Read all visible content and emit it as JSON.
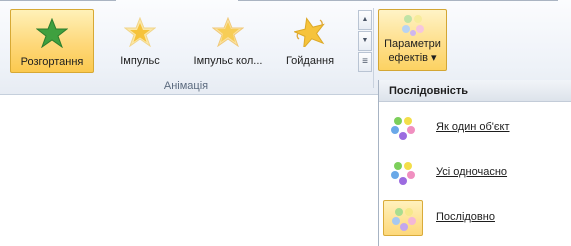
{
  "ribbon": {
    "effects": [
      {
        "label": "Розгортання",
        "selected": true,
        "color": "#3fa03f"
      },
      {
        "label": "Імпульс",
        "selected": false,
        "color": "#f6c33b"
      },
      {
        "label": "Імпульс кол...",
        "selected": false,
        "color": "#f6c33b"
      },
      {
        "label": "Гойдання",
        "selected": false,
        "color": "#f6c33b"
      }
    ],
    "group_label": "Анімація",
    "scroll": {
      "up": "▲",
      "down": "▼",
      "more": "≡"
    },
    "effect_options": {
      "line1": "Параметри",
      "line2": "ефектів ▾"
    }
  },
  "dropdown": {
    "header": "Послідовність",
    "items": [
      {
        "label": "Як один об'єкт",
        "selected": false
      },
      {
        "label": "Усі одночасно",
        "selected": false
      },
      {
        "label": "Послідовно",
        "selected": true
      }
    ]
  },
  "colors": {
    "accent_highlight": "#fdd87a",
    "dot_green": "#7ccf5a",
    "dot_yellow": "#f3de4a",
    "dot_blue": "#6aa8e8",
    "dot_pink": "#f08fc0",
    "dot_purple": "#9c6be0"
  }
}
